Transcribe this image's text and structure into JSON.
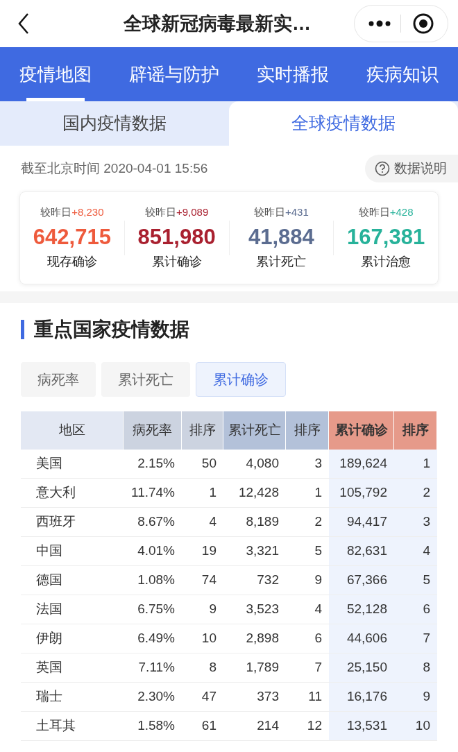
{
  "title": "全球新冠病毒最新实…",
  "nav_tabs": [
    {
      "label": "疫情地图",
      "selected": true
    },
    {
      "label": "辟谣与防护",
      "selected": false
    },
    {
      "label": "实时播报",
      "selected": false
    },
    {
      "label": "疾病知识",
      "selected": false
    }
  ],
  "sub_tabs": [
    {
      "label": "国内疫情数据",
      "selected": false
    },
    {
      "label": "全球疫情数据",
      "selected": true
    }
  ],
  "timestamp": "截至北京时间 2020-04-01 15:56",
  "info_button": "数据说明",
  "stats": [
    {
      "delta_label": "较昨日",
      "delta": "+8,230",
      "value": "642,715",
      "label": "现存确诊",
      "color": "#ee5a3c"
    },
    {
      "delta_label": "较昨日",
      "delta": "+9,089",
      "value": "851,980",
      "label": "累计确诊",
      "color": "#a9202f"
    },
    {
      "delta_label": "较昨日",
      "delta": "+431",
      "value": "41,884",
      "label": "累计死亡",
      "color": "#5b6c90"
    },
    {
      "delta_label": "较昨日",
      "delta": "+428",
      "value": "167,381",
      "label": "累计治愈",
      "color": "#27b29a"
    }
  ],
  "section_title": "重点国家疫情数据",
  "filters": [
    {
      "label": "病死率",
      "selected": false
    },
    {
      "label": "累计死亡",
      "selected": false
    },
    {
      "label": "累计确诊",
      "selected": true
    }
  ],
  "table": {
    "columns": [
      {
        "label": "地区",
        "kind": "region",
        "sorted": false
      },
      {
        "label": "病死率",
        "kind": "rate",
        "sorted": false
      },
      {
        "label": "排序",
        "kind": "rate",
        "sorted": false
      },
      {
        "label": "累计死亡",
        "kind": "death",
        "sorted": false
      },
      {
        "label": "排序",
        "kind": "death",
        "sorted": false
      },
      {
        "label": "累计确诊",
        "kind": "confirmed",
        "sorted": true
      },
      {
        "label": "排序",
        "kind": "confirmed",
        "sorted": true
      }
    ],
    "rows": [
      [
        "美国",
        "2.15%",
        "50",
        "4,080",
        "3",
        "189,624",
        "1"
      ],
      [
        "意大利",
        "11.74%",
        "1",
        "12,428",
        "1",
        "105,792",
        "2"
      ],
      [
        "西班牙",
        "8.67%",
        "4",
        "8,189",
        "2",
        "94,417",
        "3"
      ],
      [
        "中国",
        "4.01%",
        "19",
        "3,321",
        "5",
        "82,631",
        "4"
      ],
      [
        "德国",
        "1.08%",
        "74",
        "732",
        "9",
        "67,366",
        "5"
      ],
      [
        "法国",
        "6.75%",
        "9",
        "3,523",
        "4",
        "52,128",
        "6"
      ],
      [
        "伊朗",
        "6.49%",
        "10",
        "2,898",
        "6",
        "44,606",
        "7"
      ],
      [
        "英国",
        "7.11%",
        "8",
        "1,789",
        "7",
        "25,150",
        "8"
      ],
      [
        "瑞士",
        "2.30%",
        "47",
        "373",
        "11",
        "16,176",
        "9"
      ],
      [
        "土耳其",
        "1.58%",
        "61",
        "214",
        "12",
        "13,531",
        "10"
      ]
    ]
  }
}
